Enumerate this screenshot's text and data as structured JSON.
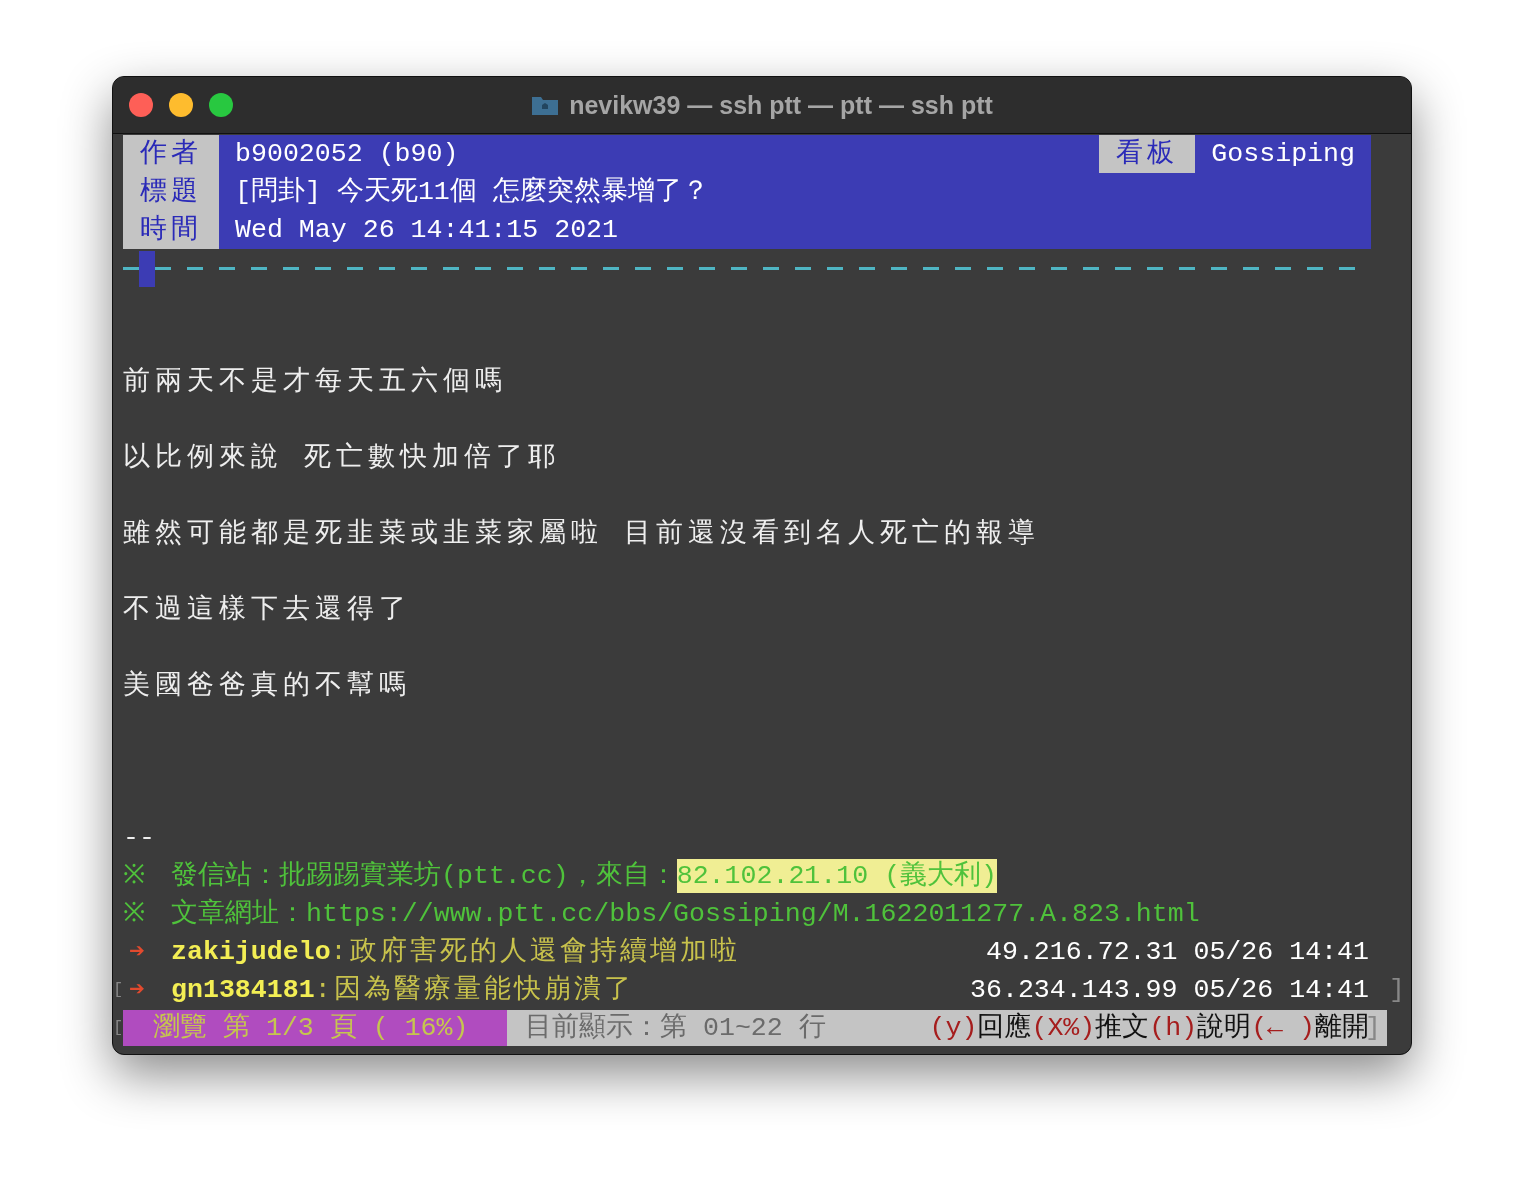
{
  "window": {
    "title": "nevikw39 — ssh ptt — ptt — ssh ptt"
  },
  "header": {
    "rows": [
      {
        "label": "作者",
        "value": "b9002052 (b90)",
        "board_label": "看板",
        "board": "Gossiping"
      },
      {
        "label": "標題",
        "value": "[問卦] 今天死11個  怎麼突然暴增了？"
      },
      {
        "label": "時間",
        "value": "Wed May 26 14:41:15 2021"
      }
    ]
  },
  "body": {
    "paragraphs": [
      "前兩天不是才每天五六個嗎",
      "以比例來說  死亡數快加倍了耶",
      "雖然可能都是死韭菜或韭菜家屬啦  目前還沒看到名人死亡的報導",
      "不過這樣下去還得了",
      "美國爸爸真的不幫嗎"
    ]
  },
  "signature": {
    "separator": "--",
    "lines": [
      {
        "mark": "※",
        "text": "發信站：批踢踢實業坊(ptt.cc)，來自：",
        "highlight": "82.102.21.10 (義大利)"
      },
      {
        "mark": "※",
        "text": "文章網址：https://www.ptt.cc/bbs/Gossiping/M.1622011277.A.823.html"
      }
    ]
  },
  "pushes": [
    {
      "arrow": "➔",
      "user": "zakijudelo",
      "content": ":政府害死的人還會持續增加啦",
      "ip_time": "49.216.72.31 05/26 14:41"
    },
    {
      "arrow": "➔",
      "user": "gn1384181",
      "content": ":因為醫療量能快崩潰了",
      "ip_time": "36.234.143.99 05/26 14:41",
      "left_edge": "[",
      "right_edge": "]"
    }
  ],
  "status": {
    "left_edge": "[",
    "right_edge": "]",
    "page": "瀏覽 第 1/3 頁 ( 16%)",
    "info": "目前顯示：第 01~22 行",
    "keys": [
      {
        "key": "(y)",
        "label": "回應"
      },
      {
        "key": "(X%)",
        "label": "推文"
      },
      {
        "key": "(h)",
        "label": "說明"
      },
      {
        "key": "(← )",
        "label": "離開"
      }
    ]
  }
}
